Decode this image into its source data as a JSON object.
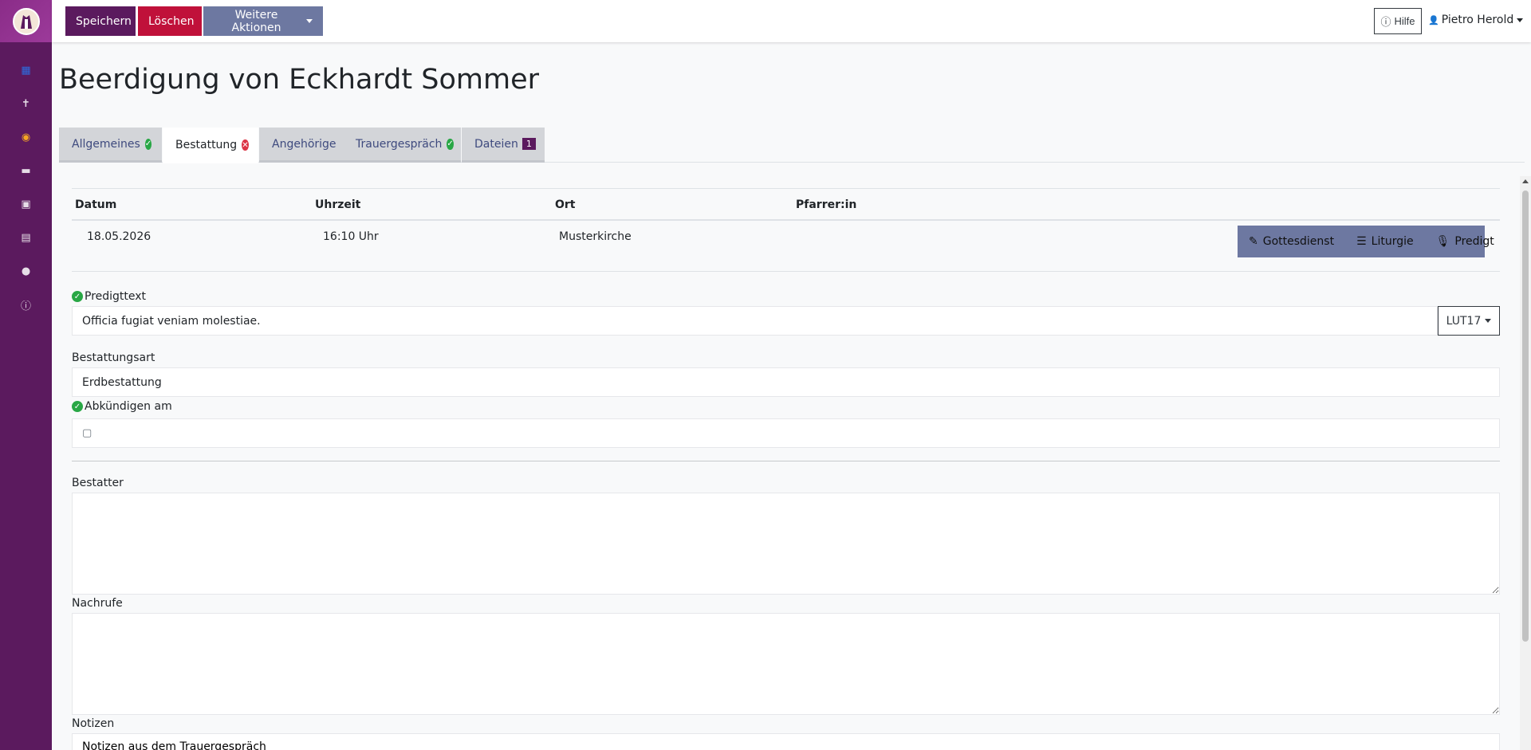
{
  "sidebar": {
    "items": [
      {
        "icon": "calendar-icon"
      },
      {
        "icon": "cross-icon"
      },
      {
        "icon": "globe-icon"
      },
      {
        "icon": "keyboard-icon"
      },
      {
        "icon": "printer-icon"
      },
      {
        "icon": "calendar-grid-icon"
      },
      {
        "icon": "user-shield-icon"
      },
      {
        "icon": "info-icon"
      }
    ]
  },
  "toolbar": {
    "save_label": "Speichern",
    "delete_label": "Löschen",
    "more_label": "Weitere Aktionen",
    "help_label": "Hilfe",
    "user_name": "Pietro Herold"
  },
  "page": {
    "title": "Beerdigung von Eckhardt Sommer"
  },
  "tabs": [
    {
      "label": "Allgemeines",
      "status": "ok"
    },
    {
      "label": "Bestattung",
      "status": "error"
    },
    {
      "label": "Angehörige",
      "status": ""
    },
    {
      "label": "Trauergespräch",
      "status": "ok"
    },
    {
      "label": "Dateien",
      "badge": "1"
    }
  ],
  "service_table": {
    "headers": [
      "Datum",
      "Uhrzeit",
      "Ort",
      "Pfarrer:in"
    ],
    "row": {
      "datum": "18.05.2026",
      "uhrzeit": "16:10 Uhr",
      "ort": "Musterkirche",
      "pfarrer": ""
    },
    "actions": [
      "Gottesdienst",
      "Liturgie",
      "Predigt"
    ]
  },
  "form": {
    "predigttext_label": "Predigttext",
    "predigttext_value": "Officia fugiat veniam molestiae.",
    "lut_label": "LUT17",
    "bestattungsart_label": "Bestattungsart",
    "bestattungsart_value": "Erdbestattung",
    "abkuendigen_label": "Abkündigen am",
    "abkuendigen_value": "",
    "bestatter_label": "Bestatter",
    "bestatter_value": "",
    "nachrufe_label": "Nachrufe",
    "nachrufe_value": "",
    "notizen_label": "Notizen",
    "notizen_value": "Notizen aus dem Trauergespräch"
  },
  "colors": {
    "brand": "#5b1a5e",
    "danger": "#c0113a",
    "secondary": "#6d78a1",
    "success": "#28a745"
  }
}
